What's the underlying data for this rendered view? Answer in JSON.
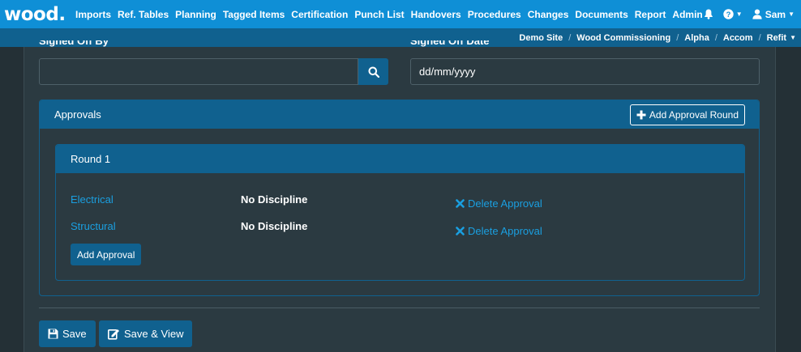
{
  "app": {
    "logo_text": "wood."
  },
  "nav": {
    "items": [
      "Imports",
      "Ref. Tables",
      "Planning",
      "Tagged Items",
      "Certification",
      "Punch List",
      "Handovers",
      "Procedures",
      "Changes",
      "Documents",
      "Report",
      "Admin"
    ],
    "user": "Sam",
    "icons": [
      "bell-icon",
      "help-icon",
      "user-icon"
    ]
  },
  "breadcrumb": {
    "items": [
      "Demo Site",
      "Wood Commissioning",
      "Alpha",
      "Accom",
      "Refit"
    ],
    "separator": "/"
  },
  "form": {
    "signed_off_by_label": "Signed Off By",
    "signed_off_by_value": "",
    "signed_off_date_label": "Signed Off Date",
    "signed_off_date_value": "dd/mm/yyyy"
  },
  "approvals": {
    "title": "Approvals",
    "add_round_label": "Add Approval Round",
    "rounds": [
      {
        "title": "Round 1",
        "approvals": [
          {
            "discipline": "Electrical",
            "status": "No Discipline",
            "delete_label": "Delete Approval"
          },
          {
            "discipline": "Structural",
            "status": "No Discipline",
            "delete_label": "Delete Approval"
          }
        ],
        "add_approval_label": "Add Approval"
      }
    ]
  },
  "actions": {
    "save_label": "Save",
    "save_view_label": "Save & View"
  },
  "colors": {
    "nav_bg": "#0f8fd6",
    "breadcrumb_bg": "#10618f",
    "page_bg": "#243036",
    "panel_bg": "#2b3a41",
    "accent": "#10618f",
    "link": "#1a9fe0"
  }
}
